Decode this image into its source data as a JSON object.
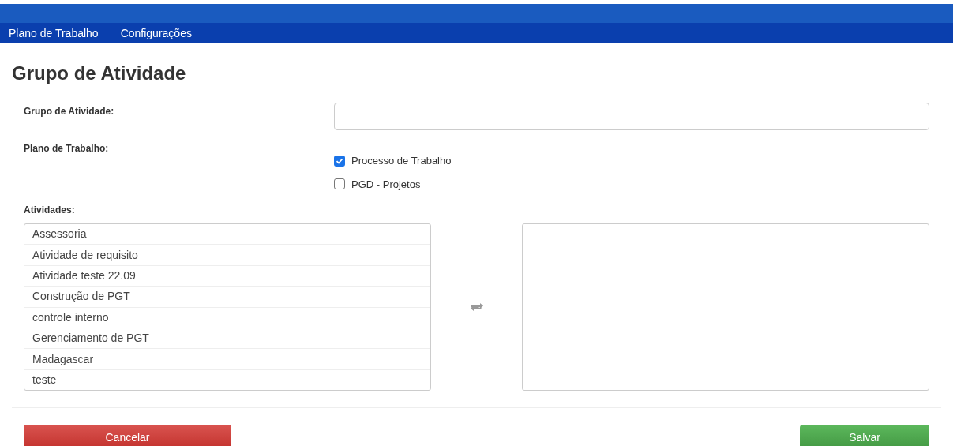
{
  "nav": {
    "items": [
      {
        "label": "Plano de Trabalho"
      },
      {
        "label": "Configurações"
      }
    ]
  },
  "page": {
    "title": "Grupo de Atividade"
  },
  "form": {
    "grupo_label": "Grupo de Atividade:",
    "plano_label": "Plano de Trabalho:",
    "plano_options": [
      {
        "label": "Processo de Trabalho",
        "checked": true
      },
      {
        "label": "PGD - Projetos",
        "checked": false
      }
    ],
    "atividades_label": "Atividades:",
    "atividades": [
      "Assessoria",
      "Atividade de requisito",
      "Atividade teste 22.09",
      "Construção de PGT",
      "controle interno",
      "Gerenciamento de PGT",
      "Madagascar",
      "teste"
    ]
  },
  "buttons": {
    "cancel": "Cancelar",
    "save": "Salvar"
  }
}
